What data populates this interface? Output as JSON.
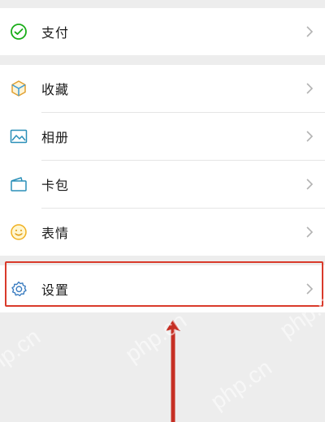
{
  "menu": {
    "pay": {
      "label": "支付",
      "icon": "pay-icon"
    },
    "favorites": {
      "label": "收藏",
      "icon": "favorites-cube-icon"
    },
    "album": {
      "label": "相册",
      "icon": "album-picture-icon"
    },
    "cards": {
      "label": "卡包",
      "icon": "card-wallet-icon"
    },
    "stickers": {
      "label": "表情",
      "icon": "smiley-icon"
    },
    "settings": {
      "label": "设置",
      "icon": "gear-icon"
    }
  },
  "watermark": "php.cn",
  "colors": {
    "highlight": "#d93a2b",
    "pay_green": "#1aad19",
    "icon_teal": "#2aa6a6",
    "icon_orange": "#f0a020",
    "icon_yellow": "#f5b800",
    "icon_blue": "#3a7cc0"
  }
}
